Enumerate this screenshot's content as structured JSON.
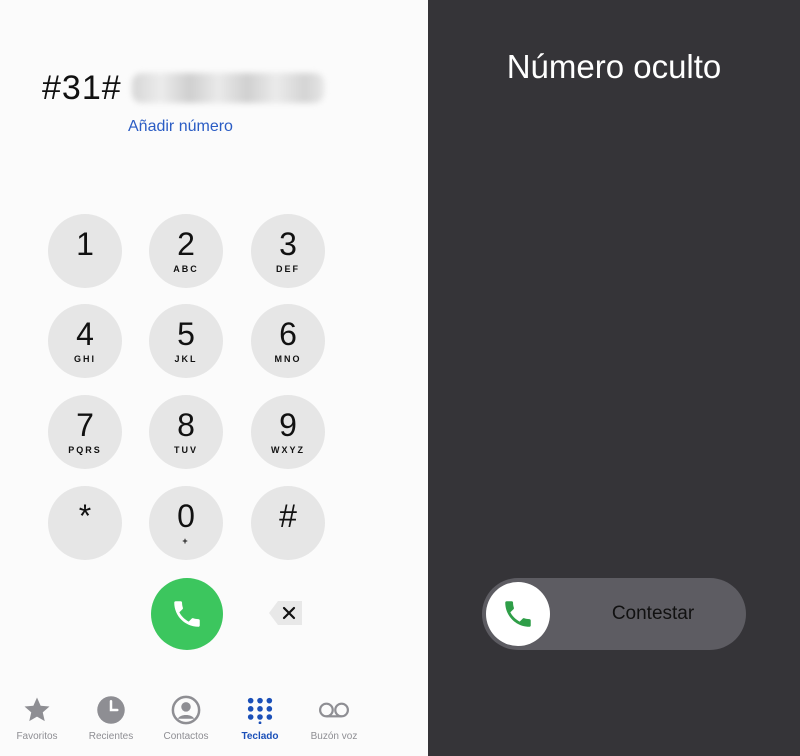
{
  "dialer": {
    "dialed_prefix": "#31#",
    "add_number_label": "Añadir número",
    "keys": [
      {
        "digit": "1",
        "letters": ""
      },
      {
        "digit": "2",
        "letters": "ABC"
      },
      {
        "digit": "3",
        "letters": "DEF"
      },
      {
        "digit": "4",
        "letters": "GHI"
      },
      {
        "digit": "5",
        "letters": "JKL"
      },
      {
        "digit": "6",
        "letters": "MNO"
      },
      {
        "digit": "7",
        "letters": "PQRS"
      },
      {
        "digit": "8",
        "letters": "TUV"
      },
      {
        "digit": "9",
        "letters": "WXYZ"
      },
      {
        "digit": "*",
        "letters": ""
      },
      {
        "digit": "0",
        "letters": "+"
      },
      {
        "digit": "#",
        "letters": ""
      }
    ],
    "call_icon": "phone-icon",
    "backspace_icon": "backspace-icon"
  },
  "tabs": [
    {
      "label": "Favoritos",
      "icon": "star-icon",
      "active": false
    },
    {
      "label": "Recientes",
      "icon": "clock-icon",
      "active": false
    },
    {
      "label": "Contactos",
      "icon": "person-circle-icon",
      "active": false
    },
    {
      "label": "Teclado",
      "icon": "keypad-icon",
      "active": true
    },
    {
      "label": "Buzón voz",
      "icon": "voicemail-icon",
      "active": false
    }
  ],
  "incoming": {
    "caller": "Número oculto",
    "slider_label": "Contestar",
    "knob_icon": "phone-icon"
  },
  "colors": {
    "call_green": "#3cc65e",
    "link_blue": "#2a5cc4",
    "active_tab_blue": "#1a4fb8",
    "incoming_bg": "#353438"
  }
}
